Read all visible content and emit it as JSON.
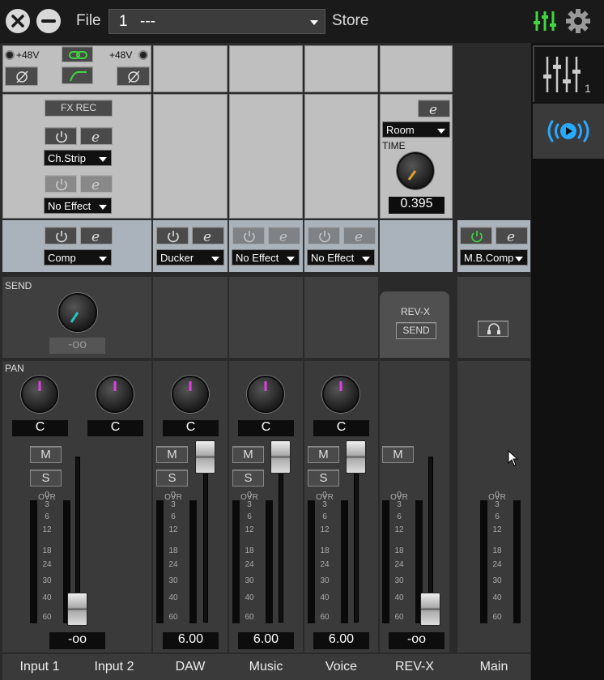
{
  "topbar": {
    "file_label": "File",
    "preset_number": "1",
    "preset_name": "---",
    "store_label": "Store"
  },
  "strip_inputs": {
    "phantom_left": "+48V",
    "phantom_right": "+48V",
    "fx_rec": "FX REC",
    "effect1": "Ch.Strip",
    "effect2": "No Effect"
  },
  "reverb": {
    "type": "Room",
    "time_label": "TIME",
    "time_value": "0.395",
    "name": "REV-X",
    "send_label": "SEND"
  },
  "inserts": {
    "input": "Comp",
    "daw": "Ducker",
    "music": "No Effect",
    "voice": "No Effect",
    "main": "M.B.Comp"
  },
  "send": {
    "label": "SEND",
    "value": "-oo"
  },
  "pan": {
    "label": "PAN",
    "input1": "C",
    "input2": "C",
    "daw": "C",
    "music": "C",
    "voice": "C"
  },
  "buttons": {
    "mute": "M",
    "solo": "S"
  },
  "meter_scale": [
    "OVR",
    "0",
    "3",
    "6",
    "12",
    "18",
    "24",
    "30",
    "40",
    "60"
  ],
  "faders": {
    "input": "-oo",
    "daw": "6.00",
    "music": "6.00",
    "voice": "6.00",
    "revx": "-oo"
  },
  "channels": [
    "Input 1",
    "Input 2",
    "DAW",
    "Music",
    "Voice",
    "REV-X",
    "Main"
  ],
  "colors": {
    "accent_green": "#3fd63f",
    "accent_blue": "#29a8ff",
    "pan_pointer": "#e040e0",
    "knob_pointer": "#e0a030"
  }
}
